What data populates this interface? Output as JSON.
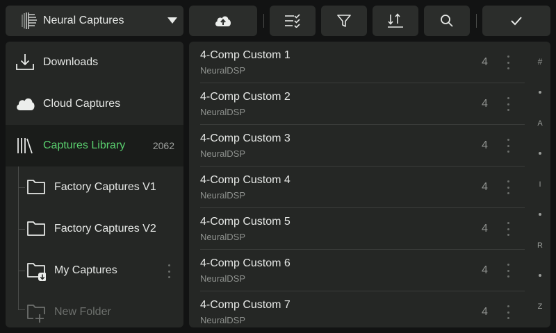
{
  "toolbar": {
    "source_label": "Neural Captures",
    "buttons": [
      {
        "name": "upload-button",
        "icon": "cloud-upload-icon"
      },
      {
        "name": "select-list-button",
        "icon": "list-check-icon"
      },
      {
        "name": "filter-button",
        "icon": "filter-icon"
      },
      {
        "name": "sort-button",
        "icon": "sort-icon"
      },
      {
        "name": "search-button",
        "icon": "search-icon"
      },
      {
        "name": "confirm-button",
        "icon": "check-icon"
      }
    ]
  },
  "sidebar": {
    "items": [
      {
        "label": "Downloads",
        "icon": "download-icon"
      },
      {
        "label": "Cloud Captures",
        "icon": "cloud-icon"
      },
      {
        "label": "Captures Library",
        "icon": "library-icon",
        "count": "2062",
        "active": true
      }
    ],
    "folders": [
      {
        "label": "Factory Captures V1",
        "icon": "folder-icon"
      },
      {
        "label": "Factory Captures V2",
        "icon": "folder-icon"
      },
      {
        "label": "My Captures",
        "icon": "folder-download-icon"
      },
      {
        "label": "New Folder",
        "icon": "folder-add-icon"
      }
    ]
  },
  "captures": [
    {
      "title": "4-Comp Custom 1",
      "author": "NeuralDSP",
      "count": "4"
    },
    {
      "title": "4-Comp Custom 2",
      "author": "NeuralDSP",
      "count": "4"
    },
    {
      "title": "4-Comp Custom 3",
      "author": "NeuralDSP",
      "count": "4"
    },
    {
      "title": "4-Comp Custom 4",
      "author": "NeuralDSP",
      "count": "4"
    },
    {
      "title": "4-Comp Custom 5",
      "author": "NeuralDSP",
      "count": "4"
    },
    {
      "title": "4-Comp Custom 6",
      "author": "NeuralDSP",
      "count": "4"
    },
    {
      "title": "4-Comp Custom 7",
      "author": "NeuralDSP",
      "count": "4"
    }
  ],
  "alpha_index": [
    "#",
    "A",
    "I",
    "R",
    "Z"
  ],
  "colors": {
    "accent": "#5ad06f",
    "panel": "#252725",
    "button": "#2b2d2b",
    "background": "#121313"
  }
}
